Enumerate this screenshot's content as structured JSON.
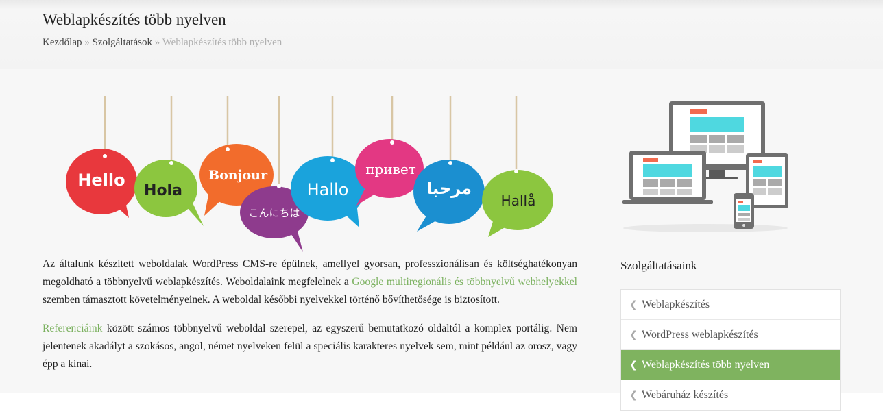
{
  "header": {
    "title": "Weblapkészítés több nyelven",
    "breadcrumb": {
      "home": "Kezdőlap",
      "separator": "»",
      "services": "Szolgáltatások",
      "current": "Weblapkészítés több nyelven"
    }
  },
  "hero": {
    "bubbles": [
      {
        "text": "Hello",
        "color": "#e8383d"
      },
      {
        "text": "Hola",
        "color": "#8cc63f"
      },
      {
        "text": "Bonjour",
        "color": "#f26c2c"
      },
      {
        "text": "こんにちは",
        "color": "#8e3b8d"
      },
      {
        "text": "Hallo",
        "color": "#1aa3dc"
      },
      {
        "text": "привет",
        "color": "#e33883"
      },
      {
        "text": "مرحبا",
        "color": "#1b8fd0"
      },
      {
        "text": "Hallå",
        "color": "#8cc63f"
      }
    ]
  },
  "article": {
    "p1_a": "Az általunk készített weboldalak WordPress CMS-re épülnek, amellyel gyorsan, professzionálisan és költséghatékonyan megoldható a többnyelvű weblapkészítés.  Weboldalaink megfelelnek a ",
    "p1_link": "Google multiregionális és többnyelvű webhelyekkel",
    "p1_b": " szemben támasztott követelményeinek. A weboldal későbbi nyelvekkel történő bővíthetősége is biztosított.",
    "p2_link": "Referenciáink",
    "p2_b": " között számos többnyelvű weboldal szerepel, az egyszerű bemutatkozó oldaltól a komplex portálig. Nem jelentenek akadályt a szokásos, angol, német nyelveken felül a speciális karakteres nyelvek sem, mint például az orosz, vagy épp a kínai."
  },
  "sidebar": {
    "title": "Szolgáltatásaink",
    "items": [
      {
        "label": "Weblapkészítés"
      },
      {
        "label": "WordPress weblapkészítés"
      },
      {
        "label": "Weblapkészítés több nyelven"
      },
      {
        "label": "Webáruház készítés"
      }
    ],
    "active_color": "#7fb35f"
  }
}
